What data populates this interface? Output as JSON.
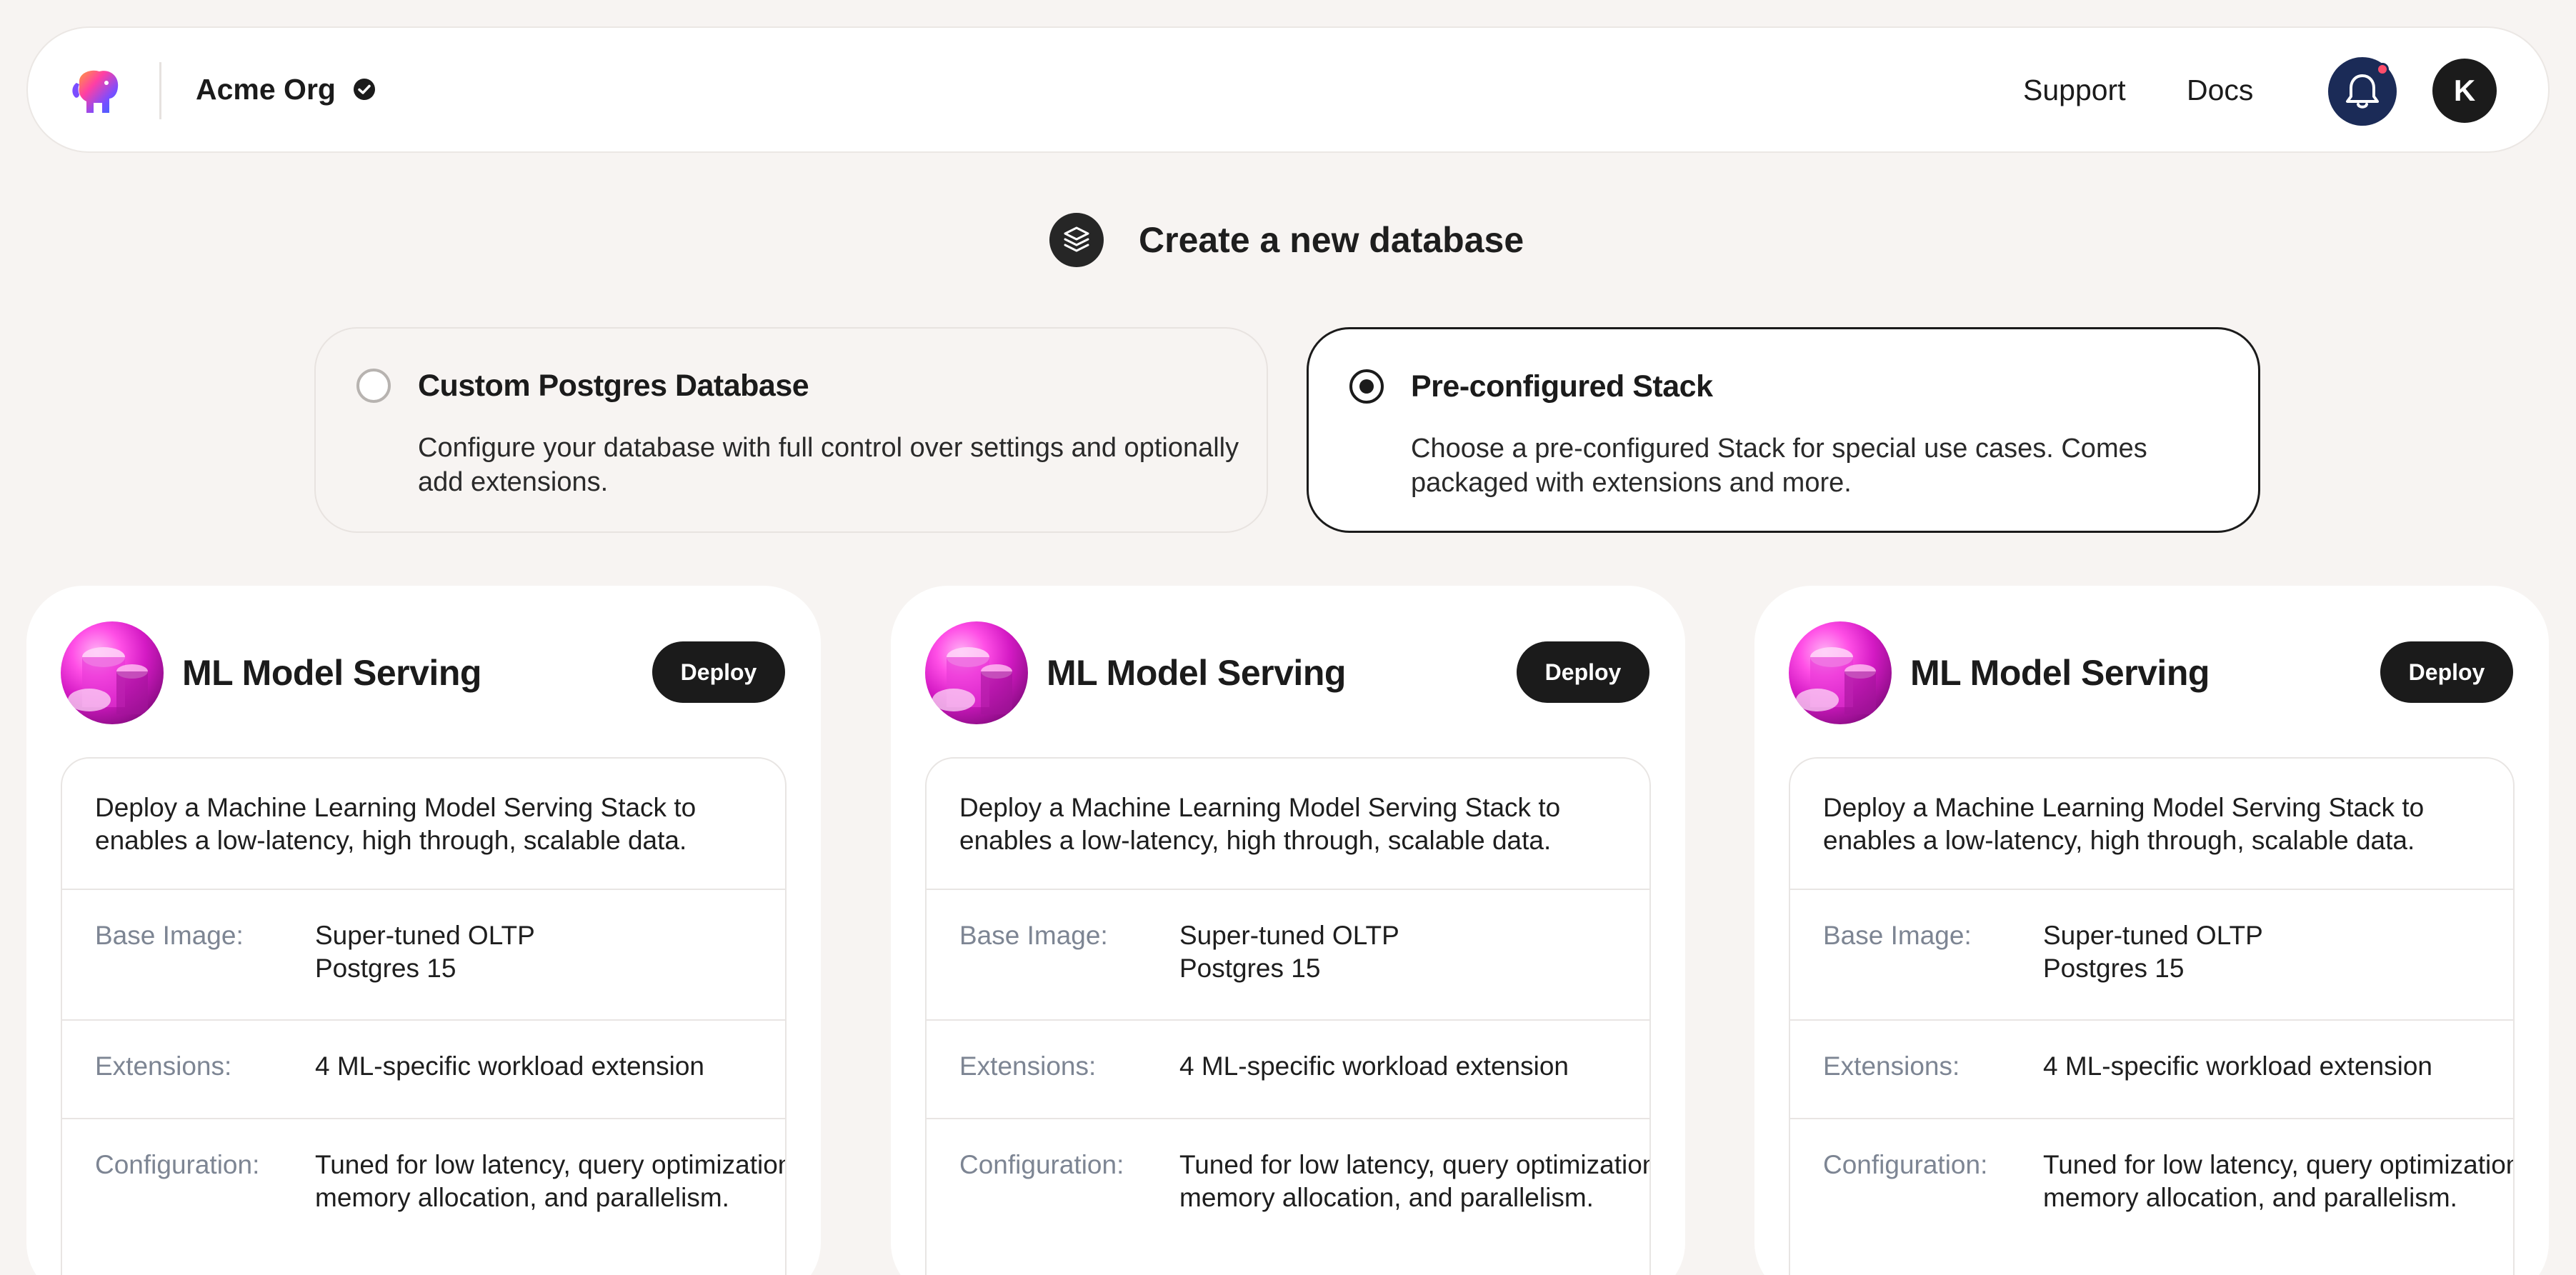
{
  "header": {
    "org_name": "Acme Org",
    "nav": {
      "support": "Support",
      "docs": "Docs"
    },
    "avatar_initial": "K",
    "icons": [
      "elephant-logo-icon",
      "verified-check-icon",
      "bell-icon"
    ]
  },
  "page": {
    "title": "Create a new database",
    "title_icon": "layers-stack-icon"
  },
  "options": [
    {
      "title": "Custom Postgres Database",
      "description": "Configure your database with full control over settings and optionally add extensions.",
      "selected": false
    },
    {
      "title": "Pre-configured Stack",
      "description": "Choose a pre-configured Stack for special use cases. Comes packaged with extensions and more.",
      "selected": true
    }
  ],
  "cards": [
    {
      "title": "ML Model Serving",
      "deploy_label": "Deploy",
      "description": "Deploy a Machine Learning Model Serving Stack to enables a low-latency, high through, scalable data.",
      "rows": [
        {
          "label": "Base Image:",
          "value": "Super-tuned OLTP Postgres 15"
        },
        {
          "label": "Extensions:",
          "value": "4 ML-specific workload extension"
        },
        {
          "label": "Configuration:",
          "value": "Tuned for low latency, query optimization, memory allocation, and parallelism."
        }
      ]
    },
    {
      "title": "ML Model Serving",
      "deploy_label": "Deploy",
      "description": "Deploy a Machine Learning Model Serving Stack to enables a low-latency, high through, scalable data.",
      "rows": [
        {
          "label": "Base Image:",
          "value": "Super-tuned OLTP Postgres 15"
        },
        {
          "label": "Extensions:",
          "value": "4 ML-specific workload extension"
        },
        {
          "label": "Configuration:",
          "value": "Tuned for low latency, query optimization, memory allocation, and parallelism."
        }
      ]
    },
    {
      "title": "ML Model Serving",
      "deploy_label": "Deploy",
      "description": "Deploy a Machine Learning Model Serving Stack to enables a low-latency, high through, scalable data.",
      "rows": [
        {
          "label": "Base Image:",
          "value": "Super-tuned OLTP Postgres 15"
        },
        {
          "label": "Extensions:",
          "value": "4 ML-specific workload extension"
        },
        {
          "label": "Configuration:",
          "value": "Tuned for low latency, query optimization, memory allocation, and parallelism."
        }
      ]
    }
  ],
  "colors": {
    "background": "#f7f4f2",
    "primary": "#1b1b1b",
    "bell_bg": "#1b2b57",
    "notification_dot": "#ff4d6b",
    "label_gray": "#7d8593",
    "card_art": "#d41ac4"
  }
}
